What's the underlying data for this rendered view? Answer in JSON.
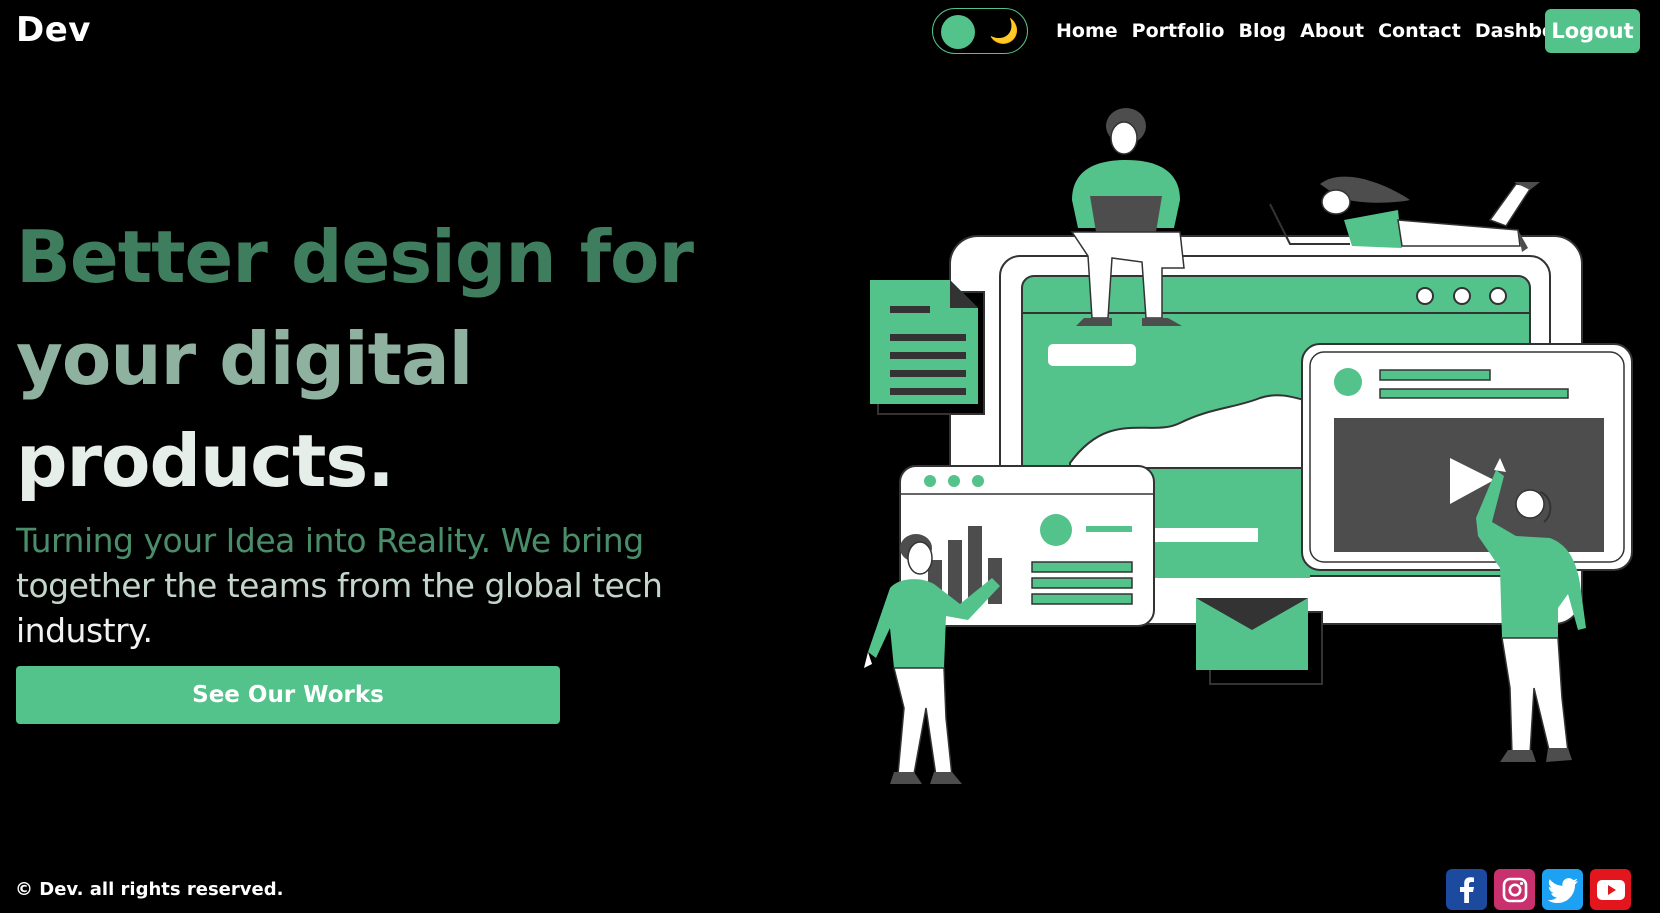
{
  "header": {
    "logo": "Dev",
    "moon_icon": "🌙",
    "nav": [
      "Home",
      "Portfolio",
      "Blog",
      "About",
      "Contact",
      "Dashboard"
    ],
    "logout_label": "Logout"
  },
  "hero": {
    "title_lines": [
      "Better design for",
      "your digital",
      "products."
    ],
    "subtitle_lines": [
      "Turning your Idea into Reality. We bring",
      "together the teams from the global tech",
      "industry."
    ],
    "cta_label": "See Our Works"
  },
  "footer": {
    "copyright": "© Dev. all rights reserved.",
    "social": [
      "facebook-icon",
      "instagram-icon",
      "twitter-icon",
      "youtube-icon"
    ]
  },
  "colors": {
    "accent": "#53c28b",
    "background": "#000000",
    "dark_grey": "#4d4d4d"
  }
}
